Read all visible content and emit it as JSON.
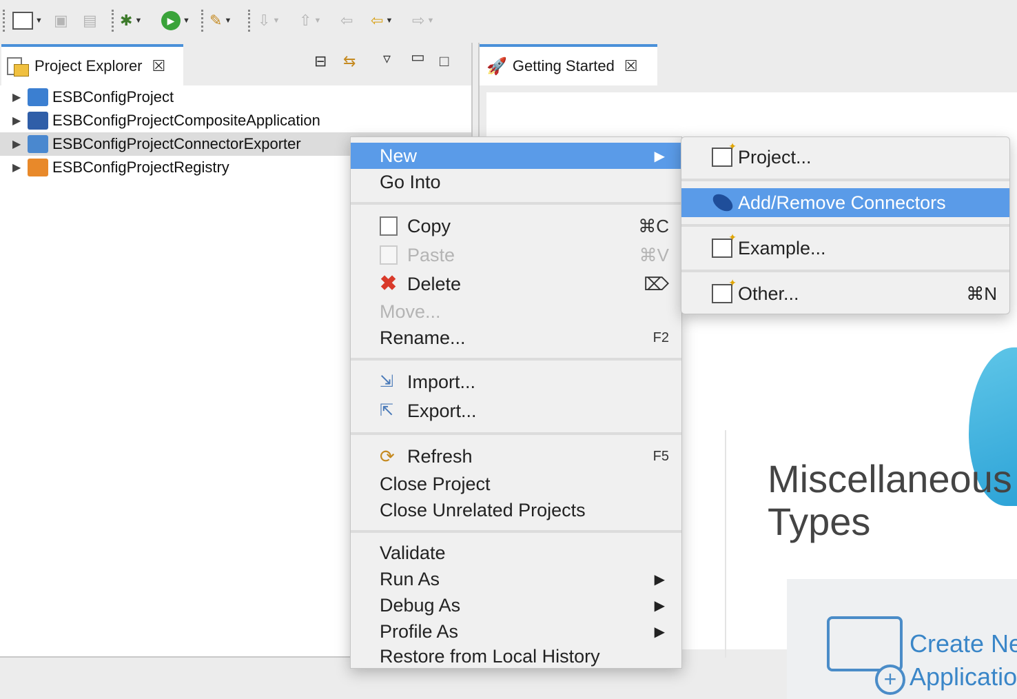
{
  "toolbar": {
    "items": [
      "new-wizard",
      "save",
      "save-all",
      "debug",
      "run",
      "external-tools",
      "next-annotation",
      "previous-annotation",
      "last-edit-location",
      "back",
      "forward"
    ]
  },
  "project_explorer": {
    "tab_label": "Project Explorer",
    "projects": [
      {
        "name": "ESBConfigProject",
        "icon_color": "#3b7fd1"
      },
      {
        "name": "ESBConfigProjectCompositeApplication",
        "icon_color": "#2f5ea8"
      },
      {
        "name": "ESBConfigProjectConnectorExporter",
        "icon_color": "#4a88cf"
      },
      {
        "name": "ESBConfigProjectRegistry",
        "icon_color": "#e8892a"
      }
    ]
  },
  "editor": {
    "tab_label": "Getting Started",
    "heading_line1": "Miscellaneous P",
    "heading_line2": "Types",
    "card_line1": "Create New",
    "card_line2": "Application"
  },
  "context_menu": {
    "new": "New",
    "go_into": "Go Into",
    "copy": "Copy",
    "copy_shortcut": "⌘C",
    "paste": "Paste",
    "paste_shortcut": "⌘V",
    "delete": "Delete",
    "delete_shortcut": "⌦",
    "move": "Move...",
    "rename": "Rename...",
    "rename_shortcut": "F2",
    "import": "Import...",
    "export": "Export...",
    "refresh": "Refresh",
    "refresh_shortcut": "F5",
    "close_project": "Close Project",
    "close_unrelated": "Close Unrelated Projects",
    "validate": "Validate",
    "run_as": "Run As",
    "debug_as": "Debug As",
    "profile_as": "Profile As",
    "restore": "Restore from Local History"
  },
  "submenu": {
    "project": "Project...",
    "add_remove_connectors": "Add/Remove Connectors",
    "example": "Example...",
    "other": "Other...",
    "other_shortcut": "⌘N"
  },
  "colors": {
    "highlight": "#5a9be8",
    "link": "#3a86c8",
    "tab_accent": "#4a90d9"
  }
}
